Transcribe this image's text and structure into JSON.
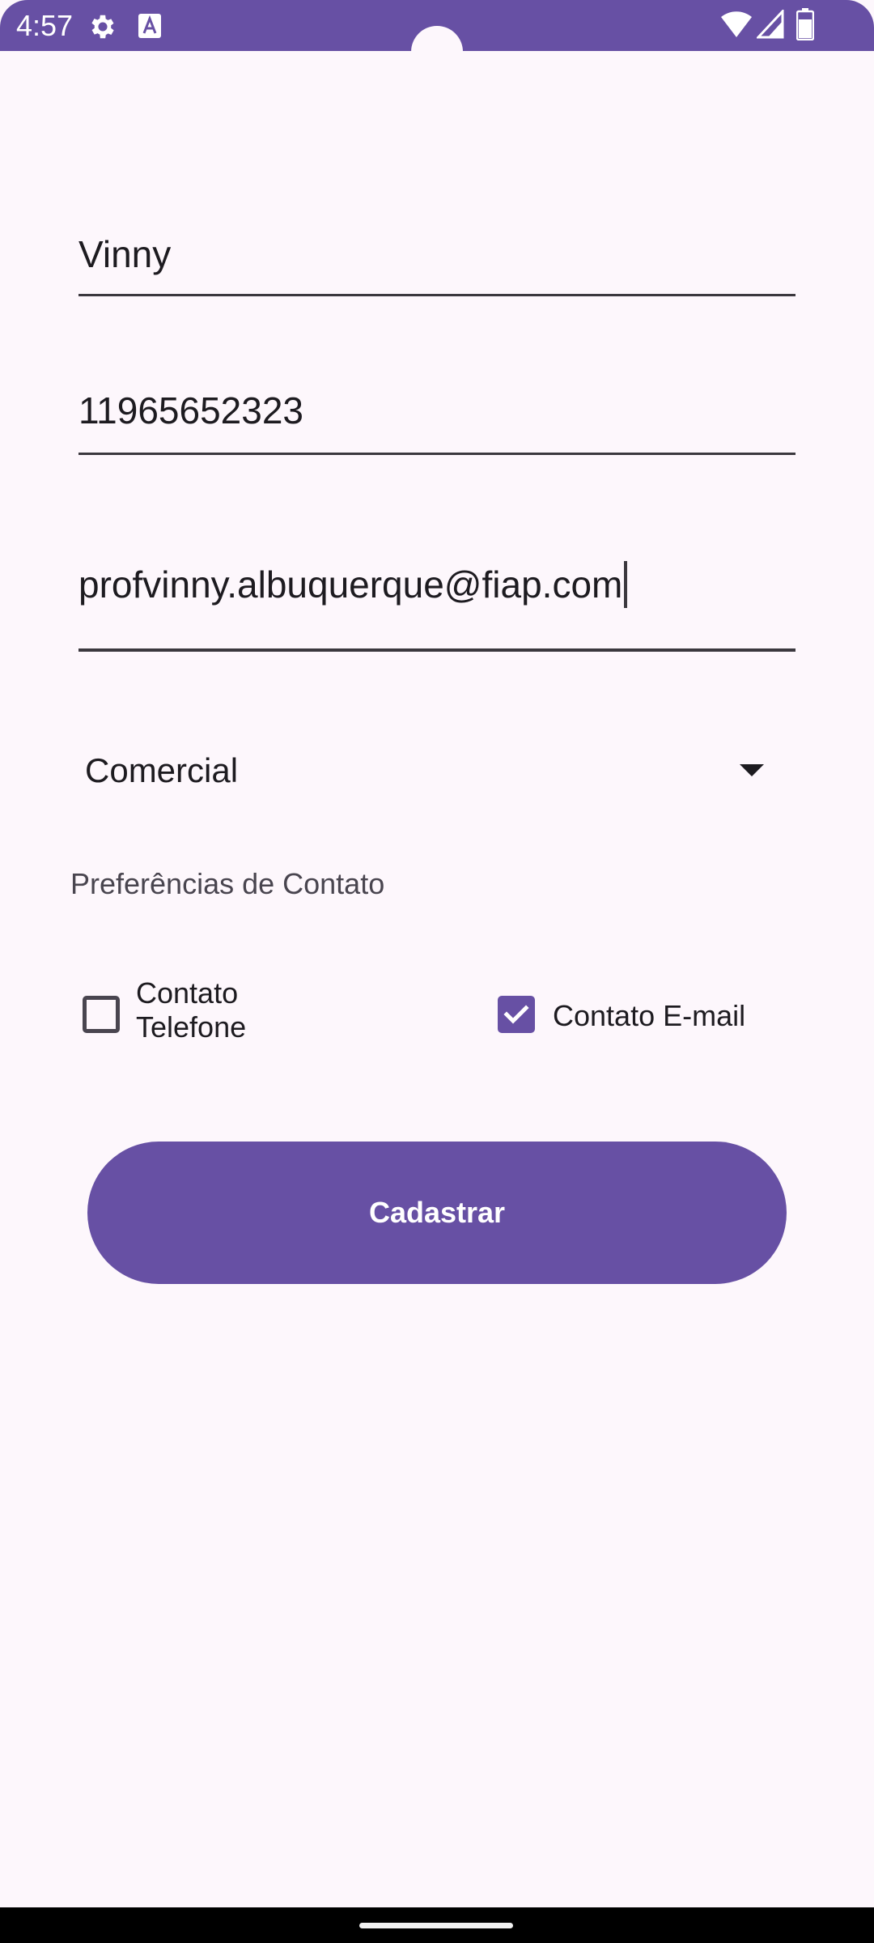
{
  "status_bar": {
    "time": "4:57",
    "icons": [
      "gear-icon",
      "text-a-icon",
      "wifi-icon",
      "signal-icon",
      "battery-icon"
    ]
  },
  "form": {
    "name_value": "Vinny",
    "phone_value": "11965652323",
    "email_value": "profvinny.albuquerque@fiap.com",
    "contact_type": {
      "selected": "Comercial"
    }
  },
  "preferences": {
    "title": "Preferências de Contato",
    "phone_checkbox": {
      "label_line1": "Contato",
      "label_line2": "Telefone",
      "checked": false
    },
    "email_checkbox": {
      "label": "Contato E-mail",
      "checked": true
    }
  },
  "actions": {
    "submit_label": "Cadastrar"
  },
  "colors": {
    "primary": "#6750a4",
    "background": "#fdf7fc",
    "on_surface": "#1d1b20",
    "on_surface_variant": "#49454f"
  }
}
